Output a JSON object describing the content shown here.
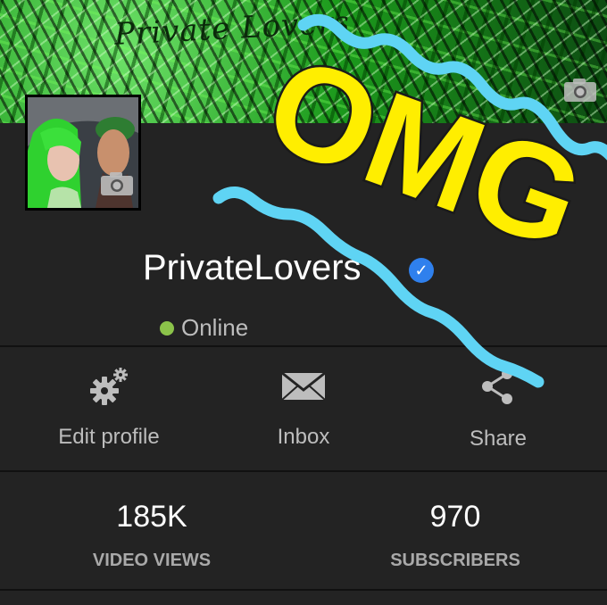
{
  "banner": {
    "title": "Private Lovers"
  },
  "profile": {
    "name": "PrivateLovers",
    "status": "Online",
    "status_color": "#8bc34a",
    "verified_color": "#2f80ed"
  },
  "actions": [
    {
      "label": "Edit profile",
      "icon": "gears-icon"
    },
    {
      "label": "Inbox",
      "icon": "envelope-icon"
    },
    {
      "label": "Share",
      "icon": "share-icon"
    }
  ],
  "stats": [
    {
      "value": "185K",
      "label": "VIDEO VIEWS"
    },
    {
      "value": "970",
      "label": "SUBSCRIBERS"
    }
  ],
  "overlay": {
    "text": "OMG",
    "text_color": "#ffee00",
    "wave_color": "#5fd4f4"
  }
}
